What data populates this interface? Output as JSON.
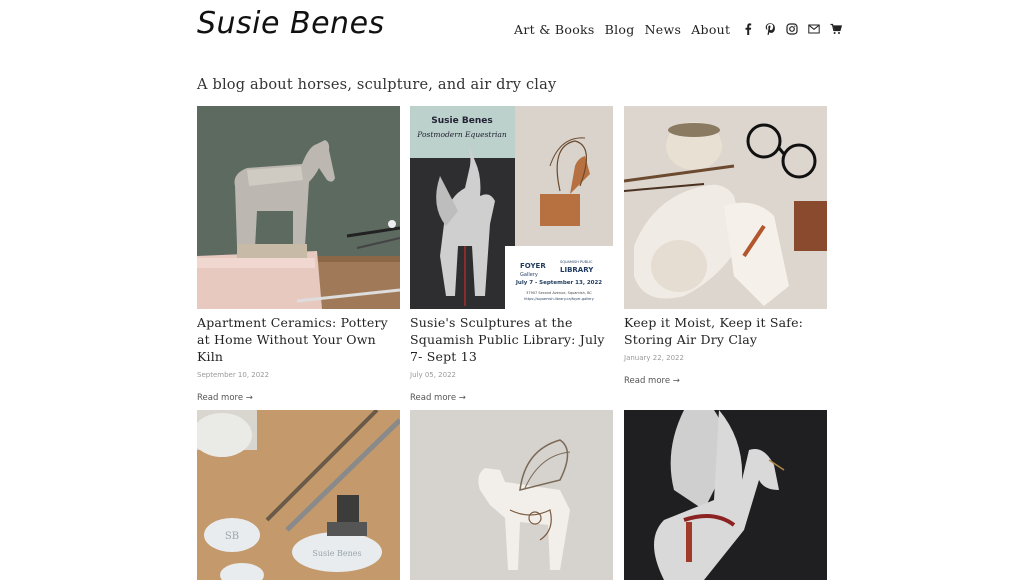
{
  "header": {
    "logo": "Susie Benes",
    "nav": [
      "Art & Books",
      "Blog",
      "News",
      "About"
    ],
    "icons": [
      "facebook-icon",
      "pinterest-icon",
      "instagram-icon",
      "mail-icon",
      "cart-icon"
    ]
  },
  "tagline": "A blog about horses, sculpture, and air dry clay",
  "posts": [
    {
      "title": "Apartment Ceramics: Pottery at Home Without Your Own Kiln",
      "date": "September 10, 2022",
      "more": "Read more →"
    },
    {
      "title": "Susie's Sculptures at the Squamish Public Library: July 7- Sept 13",
      "date": "July 05, 2022",
      "more": "Read more →"
    },
    {
      "title": "Keep it Moist, Keep it Safe: Storing Air Dry Clay",
      "date": "January 22, 2022",
      "more": "Read more →"
    }
  ],
  "poster": {
    "name": "Susie Benes",
    "script": "Postmodern Equestrian",
    "org1": "FOYER",
    "org1b": "Gallery",
    "org2": "SQUAMISH PUBLIC",
    "org2b": "LIBRARY",
    "dates": "July 7 - September 13, 2022",
    "address": "37907 Second Avenue, Squamish, BC",
    "url": "https://squamish.library.ca/foyer-gallery"
  },
  "stamps": [
    "SB",
    "Susie Benes"
  ]
}
